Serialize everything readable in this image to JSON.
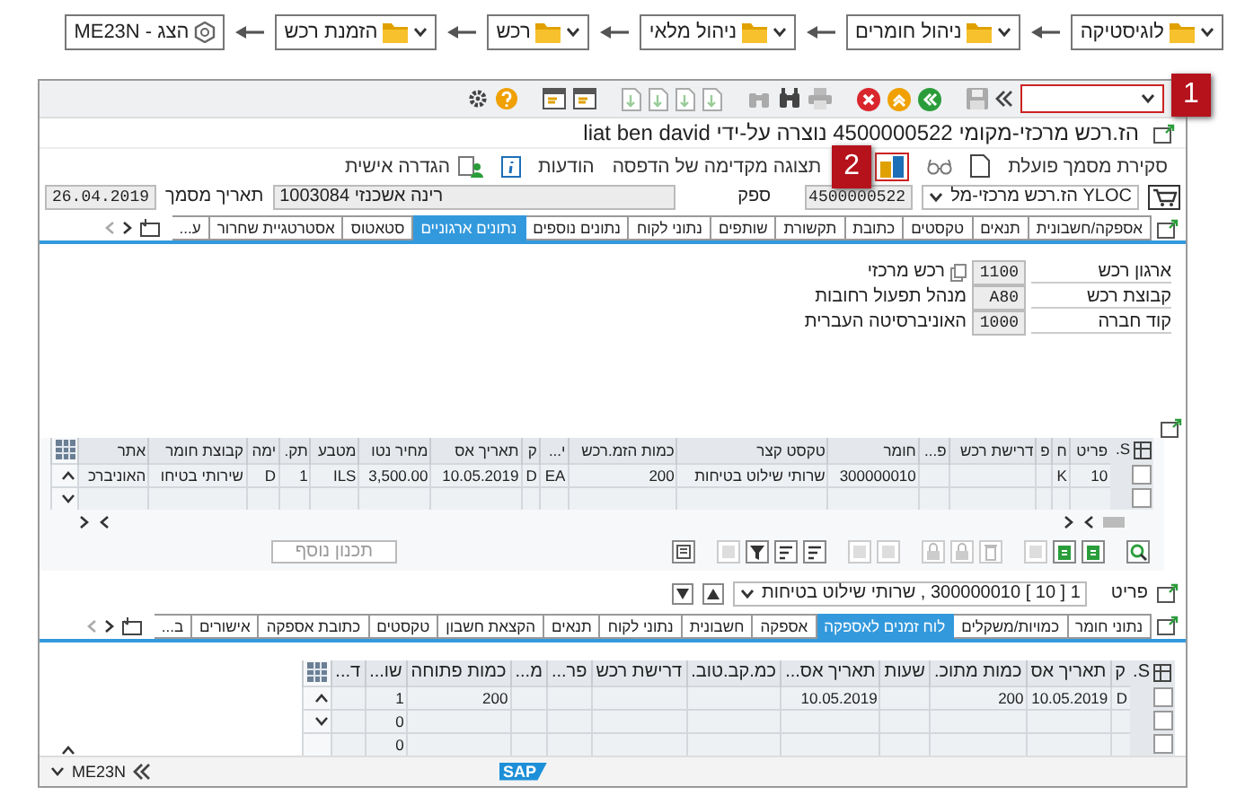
{
  "breadcrumb": [
    {
      "label": "לוגיסטיקה",
      "kind": "folder"
    },
    {
      "label": "ניהול חומרים",
      "kind": "folder"
    },
    {
      "label": "ניהול מלאי",
      "kind": "folder"
    },
    {
      "label": "רכש",
      "kind": "folder"
    },
    {
      "label": "הזמנת רכש",
      "kind": "folder"
    },
    {
      "label": "הצג - ME23N",
      "kind": "transaction"
    }
  ],
  "callouts": [
    {
      "label": "1"
    },
    {
      "label": "2"
    }
  ],
  "window": {
    "title": "הז.רכש מרכזי-מקומי 4500000522 נוצרה על-ידי liat ben david"
  },
  "app_toolbar": [
    "סקירת מסמך פועלת",
    "תצוגה מקדימה של הדפסה",
    "הודעות",
    "הגדרה אישית"
  ],
  "header": {
    "doc_type": "YLOC הז.רכש מרכזי-מל",
    "number": "4500000522",
    "vendor_label": "ספק",
    "vendor": "1003084 רינה אשכנזי",
    "date_label": "תאריך מסמך",
    "date": "26.04.2019"
  },
  "header_tabs": [
    {
      "label": "אספקה/חשבונית",
      "selected": false
    },
    {
      "label": "תנאים",
      "selected": false
    },
    {
      "label": "טקסטים",
      "selected": false
    },
    {
      "label": "כתובת",
      "selected": false
    },
    {
      "label": "תקשורת",
      "selected": false
    },
    {
      "label": "שותפים",
      "selected": false
    },
    {
      "label": "נתוני לקוח",
      "selected": false
    },
    {
      "label": "נתונים נוספים",
      "selected": false
    },
    {
      "label": "נתונים ארגוניים",
      "selected": true
    },
    {
      "label": "סטאטוס",
      "selected": false
    },
    {
      "label": "אסטרטגיית שחרור",
      "selected": false
    },
    {
      "label": "ע...",
      "selected": false
    }
  ],
  "org_fields": [
    {
      "label": "ארגון רכש",
      "value": "1100",
      "text": "רכש מרכזי"
    },
    {
      "label": "קבוצת רכש",
      "value": "A80",
      "text": "מנהל תפעול רחובות"
    },
    {
      "label": "קוד חברה",
      "value": "1000",
      "text": "האוניברסיטה העברית"
    }
  ],
  "items_table": {
    "columns": [
      "S.",
      "פריט",
      "ח",
      "פ",
      "דרישת רכש",
      "פ...",
      "חומר",
      "טקסט קצר",
      "כמות הזמ.רכש",
      "י...",
      "ק",
      "תאריך אס",
      "מחיר נטו",
      "מטבע",
      "תק.",
      "ימה",
      "קבוצת חומר",
      "אתר"
    ],
    "rows": [
      {
        "cells": [
          "",
          "10",
          "K",
          "",
          "",
          "",
          "300000010",
          "שרותי שילוט בטיחות",
          "200",
          "EA",
          "D",
          "10.05.2019",
          "3,500.00",
          "ILS",
          "1",
          "D",
          "שירותי בטיחו",
          "האוניברכ"
        ]
      },
      {
        "cells": [
          "",
          "",
          "",
          "",
          "",
          "",
          "",
          "",
          "",
          "",
          "",
          "",
          "",
          "",
          "",
          "",
          "",
          ""
        ]
      }
    ]
  },
  "extra_planning_button": {
    "label": "תכנון נוסף",
    "disabled": true
  },
  "item_selector": {
    "label": "פריט",
    "value": "1 [ 10 ] 300000010 , שרותי שילוט בטיחות"
  },
  "item_tabs": [
    {
      "label": "נתוני חומר",
      "selected": false
    },
    {
      "label": "כמויות/משקלים",
      "selected": false
    },
    {
      "label": "לוח זמנים לאספקה",
      "selected": true
    },
    {
      "label": "אספקה",
      "selected": false
    },
    {
      "label": "חשבונית",
      "selected": false
    },
    {
      "label": "נתוני לקוח",
      "selected": false
    },
    {
      "label": "תנאים",
      "selected": false
    },
    {
      "label": "הקצאת חשבון",
      "selected": false
    },
    {
      "label": "טקסטים",
      "selected": false
    },
    {
      "label": "כתובת אספקה",
      "selected": false
    },
    {
      "label": "אישורים",
      "selected": false
    },
    {
      "label": "ב...",
      "selected": false
    }
  ],
  "schedule_table": {
    "columns": [
      "S.",
      "ק",
      "תאריך אס",
      "כמות מתוכ.",
      "שעות",
      "תאריך אס...",
      "כמ.קב.טוב.",
      "דרישת רכש",
      "פר...",
      "מ...",
      "כמות פתוחה",
      "שו...",
      "ד..."
    ],
    "rows": [
      {
        "cells": [
          "",
          "D",
          "10.05.2019",
          "200",
          "",
          "10.05.2019",
          "",
          "",
          "",
          "",
          "200",
          "1",
          ""
        ]
      },
      {
        "cells": [
          "",
          "",
          "",
          "",
          "",
          "",
          "",
          "",
          "",
          "",
          "",
          "0",
          ""
        ]
      },
      {
        "cells": [
          "",
          "",
          "",
          "",
          "",
          "",
          "",
          "",
          "",
          "",
          "",
          "0",
          ""
        ]
      }
    ]
  },
  "status_bar": {
    "transaction": "ME23N",
    "logo": "SAP"
  }
}
